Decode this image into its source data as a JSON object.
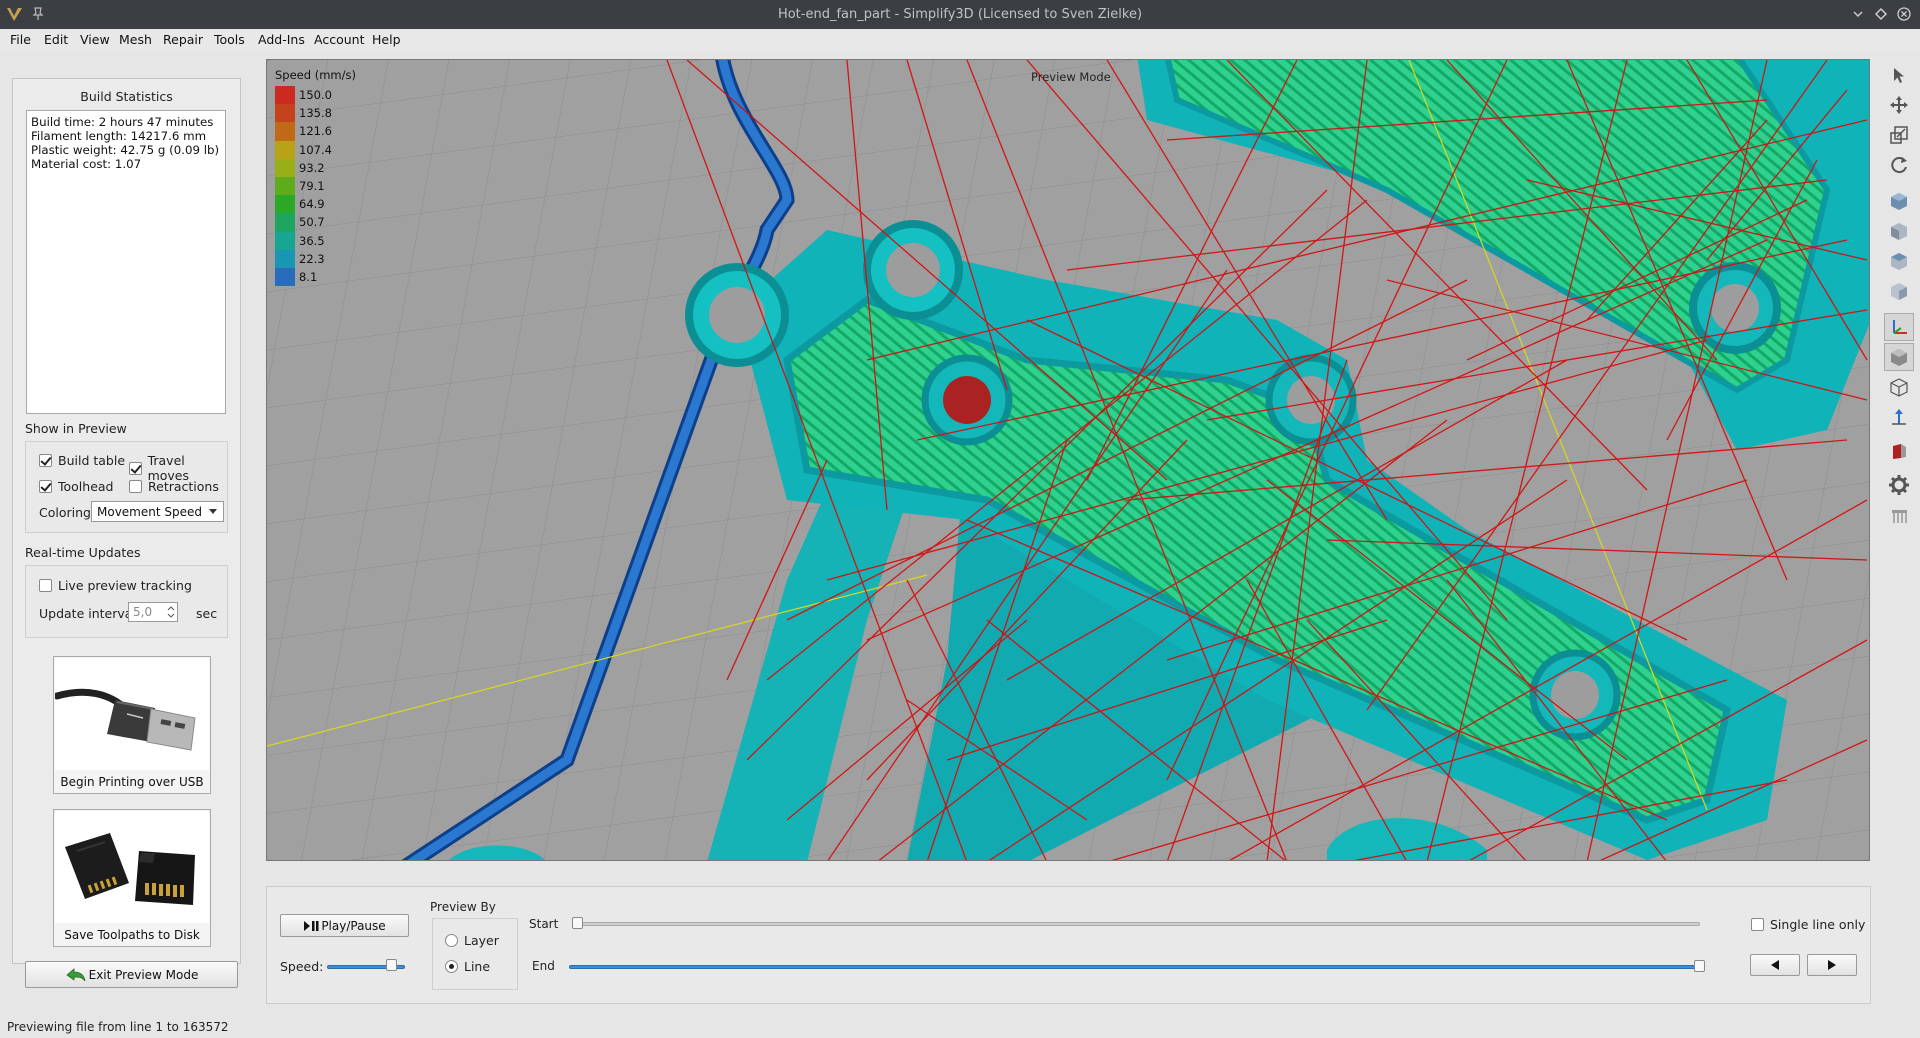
{
  "window": {
    "title": "Hot-end_fan_part - Simplify3D (Licensed to Sven Zielke)"
  },
  "menu": [
    "File",
    "Edit",
    "View",
    "Mesh",
    "Repair",
    "Tools",
    "Add-Ins",
    "Account",
    "Help"
  ],
  "build_statistics": {
    "heading": "Build Statistics",
    "lines": [
      "Build time: 2 hours 47 minutes",
      "Filament length: 14217.6 mm",
      "Plastic weight: 42.75 g (0.09 lb)",
      "Material cost: 1.07"
    ]
  },
  "show_in_preview": {
    "title": "Show in Preview",
    "build_table": {
      "label": "Build table",
      "checked": true
    },
    "travel_moves": {
      "label": "Travel moves",
      "checked": true
    },
    "toolhead": {
      "label": "Toolhead",
      "checked": true
    },
    "retractions": {
      "label": "Retractions",
      "checked": false
    },
    "coloring_label": "Coloring",
    "coloring_value": "Movement Speed"
  },
  "realtime_updates": {
    "title": "Real-time Updates",
    "live_tracking": {
      "label": "Live preview tracking",
      "checked": false
    },
    "interval_label": "Update interval",
    "interval_value": "5,0",
    "interval_unit": "sec"
  },
  "actions": {
    "usb_label": "Begin Printing over USB",
    "disk_label": "Save Toolpaths to Disk",
    "exit_label": "Exit Preview Mode"
  },
  "legend": {
    "title": "Speed (mm/s)",
    "entries": [
      {
        "value": "150.0",
        "color": "#cc2a20"
      },
      {
        "value": "135.8",
        "color": "#c4421c"
      },
      {
        "value": "121.6",
        "color": "#c06a18"
      },
      {
        "value": "107.4",
        "color": "#b8a216"
      },
      {
        "value": "93.2",
        "color": "#9aae16"
      },
      {
        "value": "79.1",
        "color": "#5eac1c"
      },
      {
        "value": "64.9",
        "color": "#2aa826"
      },
      {
        "value": "50.7",
        "color": "#1ea660"
      },
      {
        "value": "36.5",
        "color": "#18a692"
      },
      {
        "value": "22.3",
        "color": "#1896b4"
      },
      {
        "value": "8.1",
        "color": "#2a6cbc"
      }
    ]
  },
  "viewport": {
    "mode_label": "Preview Mode"
  },
  "playback": {
    "play_label": "Play/Pause",
    "speed_label": "Speed:",
    "speed_level": 0.85,
    "preview_by_label": "Preview By",
    "layer_label": "Layer",
    "line_label": "Line",
    "selected": "Line",
    "start_label": "Start",
    "end_label": "End",
    "start_position": 0.0,
    "end_position": 1.0,
    "single_line_label": "Single line only",
    "single_line_checked": false
  },
  "status": {
    "text": "Previewing file from line 1 to 163572"
  }
}
